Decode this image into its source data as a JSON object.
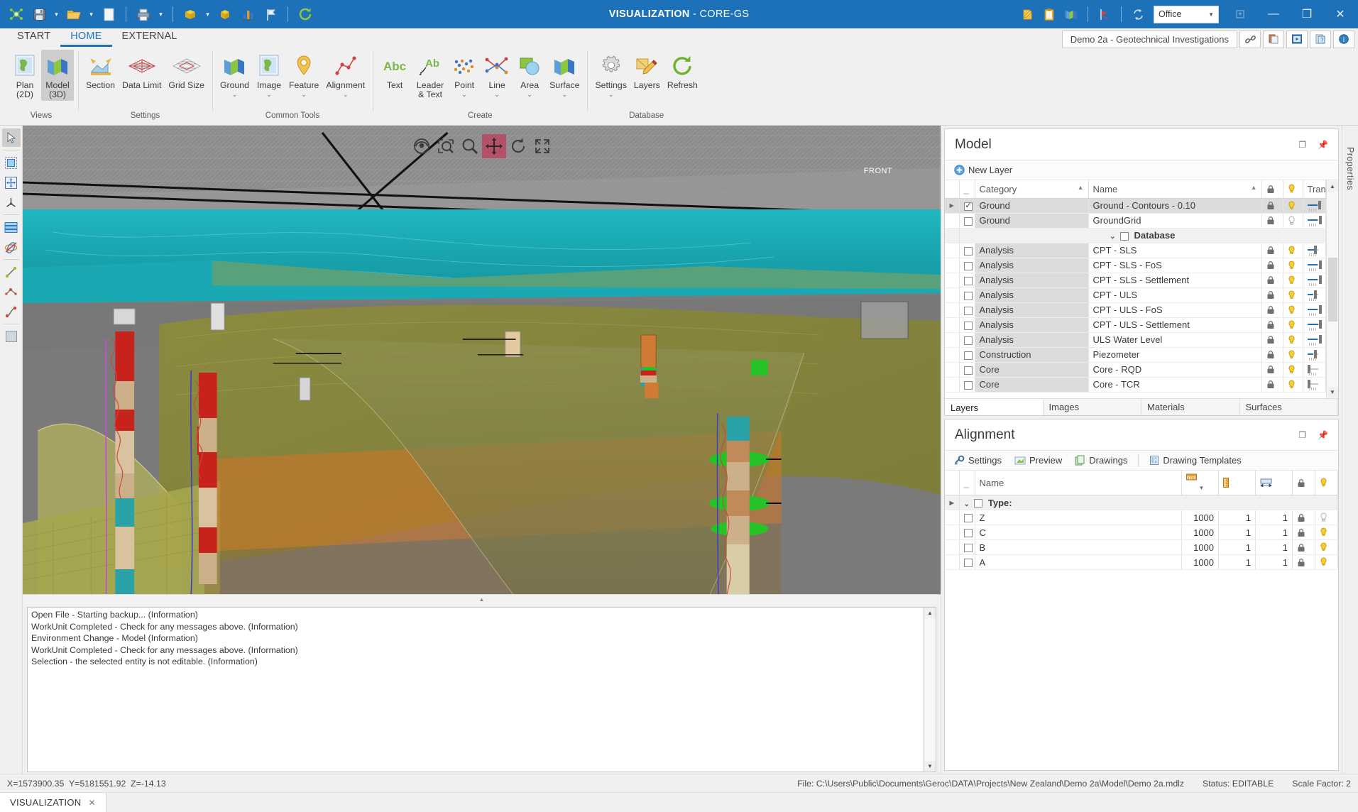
{
  "titlebar": {
    "app_title_prefix": "VISUALIZATION",
    "app_title_suffix": " - CORE-GS",
    "quick_access": [
      {
        "name": "network-icon",
        "label": "Network"
      },
      {
        "name": "save-icon",
        "label": "Save"
      },
      {
        "name": "save-dropdown",
        "label": "Save options"
      },
      {
        "name": "open-folder-icon",
        "label": "Open"
      },
      {
        "name": "open-dropdown",
        "label": "Open options"
      },
      {
        "name": "new-document-icon",
        "label": "New"
      },
      {
        "name": "print-icon",
        "label": "Print"
      },
      {
        "name": "print-dropdown",
        "label": "Print options"
      },
      {
        "name": "cube-yellow-icon",
        "label": "Model"
      },
      {
        "name": "cube-dropdown",
        "label": "Model options"
      },
      {
        "name": "cube-solid-icon",
        "label": "Solid"
      },
      {
        "name": "chart-icon",
        "label": "Chart"
      },
      {
        "name": "flag-icon",
        "label": "Flag"
      },
      {
        "name": "refresh-icon",
        "label": "Refresh"
      }
    ],
    "right_icons": [
      {
        "name": "edit-note-icon",
        "label": "Notes"
      },
      {
        "name": "clipboard-icon",
        "label": "Clipboard"
      },
      {
        "name": "map-icon",
        "label": "Map"
      },
      {
        "name": "section-icon",
        "label": "Section"
      },
      {
        "name": "sync-icon",
        "label": "Sync"
      }
    ],
    "environment_select": "Office",
    "window_buttons": {
      "restore_up": "⇧",
      "minimize": "—",
      "maximize": "❐",
      "close": "✕"
    }
  },
  "ribbon": {
    "tabs": [
      {
        "label": "START",
        "active": false
      },
      {
        "label": "HOME",
        "active": true
      },
      {
        "label": "EXTERNAL",
        "active": false
      }
    ],
    "document_title": "Demo 2a - Geotechnical Investigations",
    "doc_buttons": [
      {
        "name": "link-icon",
        "label": "Link"
      },
      {
        "name": "paste-clipboard-icon",
        "label": "Paste"
      },
      {
        "name": "movie-icon",
        "label": "Movie"
      },
      {
        "name": "help-page-icon",
        "label": "Help"
      },
      {
        "name": "info-icon",
        "label": "Info"
      }
    ],
    "groups": [
      {
        "label": "Views",
        "items": [
          {
            "name": "plan-2d-button",
            "label": "Plan",
            "label2": "(2D)",
            "icon": "map-plan-icon",
            "selected": false,
            "dropdown": false
          },
          {
            "name": "model-3d-button",
            "label": "Model",
            "label2": "(3D)",
            "icon": "map-3d-icon",
            "selected": true,
            "dropdown": false
          }
        ]
      },
      {
        "label": "Settings",
        "items": [
          {
            "name": "section-button",
            "label": "Section",
            "label2": "",
            "icon": "section-icon",
            "selected": false,
            "dropdown": false
          },
          {
            "name": "data-limit-button",
            "label": "Data Limit",
            "label2": "",
            "icon": "data-limit-icon",
            "selected": false,
            "dropdown": false
          },
          {
            "name": "grid-size-button",
            "label": "Grid Size",
            "label2": "",
            "icon": "grid-size-icon",
            "selected": false,
            "dropdown": false
          }
        ]
      },
      {
        "label": "Common Tools",
        "items": [
          {
            "name": "ground-button",
            "label": "Ground",
            "label2": "",
            "icon": "map-3d-icon",
            "selected": false,
            "dropdown": true
          },
          {
            "name": "image-button",
            "label": "Image",
            "label2": "",
            "icon": "map-plan-icon",
            "selected": false,
            "dropdown": true
          },
          {
            "name": "feature-button",
            "label": "Feature",
            "label2": "",
            "icon": "pin-icon",
            "selected": false,
            "dropdown": true
          },
          {
            "name": "alignment-button",
            "label": "Alignment",
            "label2": "",
            "icon": "polyline-icon",
            "selected": false,
            "dropdown": true
          }
        ]
      },
      {
        "label": "Create",
        "items": [
          {
            "name": "text-button",
            "label": "Text",
            "label2": "",
            "icon": "abc-text-icon",
            "selected": false,
            "dropdown": false
          },
          {
            "name": "leader-text-button",
            "label": "Leader",
            "label2": "& Text",
            "icon": "leader-text-icon",
            "selected": false,
            "dropdown": false
          },
          {
            "name": "point-button",
            "label": "Point",
            "label2": "",
            "icon": "points-icon",
            "selected": false,
            "dropdown": true
          },
          {
            "name": "line-button",
            "label": "Line",
            "label2": "",
            "icon": "lines-icon",
            "selected": false,
            "dropdown": true
          },
          {
            "name": "area-button",
            "label": "Area",
            "label2": "",
            "icon": "area-icon",
            "selected": false,
            "dropdown": true
          },
          {
            "name": "surface-button",
            "label": "Surface",
            "label2": "",
            "icon": "map-3d-icon",
            "selected": false,
            "dropdown": true
          }
        ]
      },
      {
        "label": "Database",
        "items": [
          {
            "name": "settings-button",
            "label": "Settings",
            "label2": "",
            "icon": "gear-icon",
            "selected": false,
            "dropdown": true
          },
          {
            "name": "layers-button",
            "label": "Layers",
            "label2": "",
            "icon": "layers-pencil-icon",
            "selected": false,
            "dropdown": false
          },
          {
            "name": "refresh-button",
            "label": "Refresh",
            "label2": "",
            "icon": "refresh-green-icon",
            "selected": false,
            "dropdown": false
          }
        ]
      }
    ]
  },
  "left_toolbar": [
    {
      "name": "select-arrow-tool",
      "selected": true
    },
    {
      "name": "select-window-tool",
      "selected": false
    },
    {
      "name": "move-tool",
      "selected": false
    },
    {
      "name": "axis-tool",
      "selected": false
    },
    {
      "name": "table-tool",
      "selected": false
    },
    {
      "name": "no-orbit-tool",
      "selected": false
    },
    {
      "name": "measure-line-tool",
      "selected": false
    },
    {
      "name": "polyline-tool",
      "selected": false
    },
    {
      "name": "curve-tool",
      "selected": false
    },
    {
      "name": "surface-tool",
      "selected": false
    }
  ],
  "viewport": {
    "tools": [
      {
        "name": "eye-view-tool",
        "active": false
      },
      {
        "name": "zoom-window-tool",
        "active": false
      },
      {
        "name": "zoom-tool",
        "active": false
      },
      {
        "name": "pan-tool",
        "active": true
      },
      {
        "name": "rotate-tool",
        "active": false
      },
      {
        "name": "zoom-extents-tool",
        "active": false
      }
    ],
    "viewcube_label": "FRONT",
    "accent_active_color": "#be3c5a"
  },
  "console": {
    "lines": [
      "Open File - Starting backup... (Information)",
      "WorkUnit Completed - Check for any messages above. (Information)",
      "Environment Change - Model (Information)",
      "WorkUnit Completed - Check for any messages above. (Information)",
      "Selection - the selected entity is not editable. (Information)"
    ]
  },
  "model_panel": {
    "title": "Model",
    "new_layer_label": "New Layer",
    "columns": [
      "",
      "_",
      "Category",
      "Name",
      "lock",
      "bulb",
      "Transparency"
    ],
    "column_labels": {
      "category": "Category",
      "name": "Name",
      "transparency": "Transparency"
    },
    "rows": [
      {
        "expander": true,
        "checked": true,
        "category": "Ground",
        "name": "Ground - Contours - 0.10",
        "lock": "locked",
        "bulb": "on",
        "transparency": 92,
        "selected": true,
        "group": false
      },
      {
        "expander": false,
        "checked": false,
        "category": "Ground",
        "name": "GroundGrid",
        "lock": "locked",
        "bulb": "off",
        "transparency": 95,
        "selected": false,
        "group": false
      },
      {
        "group": true,
        "label": "Database",
        "checked": false
      },
      {
        "expander": false,
        "checked": false,
        "category": "Analysis",
        "name": "CPT - SLS",
        "lock": "locked",
        "bulb": "on",
        "transparency": 60,
        "selected": false,
        "group": false
      },
      {
        "expander": false,
        "checked": false,
        "category": "Analysis",
        "name": "CPT - SLS - FoS",
        "lock": "locked",
        "bulb": "on",
        "transparency": 96,
        "selected": false,
        "group": false
      },
      {
        "expander": false,
        "checked": false,
        "category": "Analysis",
        "name": "CPT - SLS - Settlement",
        "lock": "locked",
        "bulb": "on",
        "transparency": 95,
        "selected": false,
        "group": false
      },
      {
        "expander": false,
        "checked": false,
        "category": "Analysis",
        "name": "CPT - ULS",
        "lock": "locked",
        "bulb": "on",
        "transparency": 58,
        "selected": false,
        "group": false
      },
      {
        "expander": false,
        "checked": false,
        "category": "Analysis",
        "name": "CPT - ULS - FoS",
        "lock": "locked",
        "bulb": "on",
        "transparency": 96,
        "selected": false,
        "group": false
      },
      {
        "expander": false,
        "checked": false,
        "category": "Analysis",
        "name": "CPT - ULS - Settlement",
        "lock": "locked",
        "bulb": "on",
        "transparency": 97,
        "selected": false,
        "group": false
      },
      {
        "expander": false,
        "checked": false,
        "category": "Analysis",
        "name": "ULS Water Level",
        "lock": "locked",
        "bulb": "on",
        "transparency": 96,
        "selected": false,
        "group": false
      },
      {
        "expander": false,
        "checked": false,
        "category": "Construction",
        "name": "Piezometer",
        "lock": "locked",
        "bulb": "on",
        "transparency": 58,
        "selected": false,
        "group": false
      },
      {
        "expander": false,
        "checked": false,
        "category": "Core",
        "name": "Core - RQD",
        "lock": "locked",
        "bulb": "on",
        "transparency": 12,
        "selected": false,
        "group": false
      },
      {
        "expander": false,
        "checked": false,
        "category": "Core",
        "name": "Core - TCR",
        "lock": "locked",
        "bulb": "on",
        "transparency": 12,
        "selected": false,
        "group": false
      }
    ],
    "tabs": [
      {
        "label": "Layers",
        "active": true
      },
      {
        "label": "Images",
        "active": false
      },
      {
        "label": "Materials",
        "active": false
      },
      {
        "label": "Surfaces",
        "active": false
      }
    ]
  },
  "alignment_panel": {
    "title": "Alignment",
    "toolbar": [
      {
        "name": "settings-button",
        "label": "Settings",
        "icon": "wrench-icon"
      },
      {
        "name": "preview-button",
        "label": "Preview",
        "icon": "preview-icon"
      },
      {
        "name": "drawings-button",
        "label": "Drawings",
        "icon": "drawings-icon"
      },
      {
        "name": "drawing-templates-button",
        "label": "Drawing Templates",
        "icon": "template-icon"
      }
    ],
    "columns": {
      "name": "Name"
    },
    "header_icons": [
      {
        "name": "ruler-table-icon"
      },
      {
        "name": "chevron-down-icon"
      },
      {
        "name": "ruler-vertical-icon"
      },
      {
        "name": "width-icon"
      },
      {
        "name": "lock-icon"
      },
      {
        "name": "bulb-icon"
      }
    ],
    "group_label": "Type:",
    "rows": [
      {
        "checked": false,
        "name": "Z",
        "v1": "1000",
        "v2": "1",
        "v3": "1",
        "lock": "locked",
        "bulb": "off"
      },
      {
        "checked": false,
        "name": "C",
        "v1": "1000",
        "v2": "1",
        "v3": "1",
        "lock": "locked",
        "bulb": "on"
      },
      {
        "checked": false,
        "name": "B",
        "v1": "1000",
        "v2": "1",
        "v3": "1",
        "lock": "locked",
        "bulb": "on"
      },
      {
        "checked": false,
        "name": "A",
        "v1": "1000",
        "v2": "1",
        "v3": "1",
        "lock": "locked",
        "bulb": "on"
      }
    ]
  },
  "properties_rail": {
    "label": "Properties"
  },
  "statusbar": {
    "coords": "X=1573900.35  Y=5181551.92  Z=-14.13",
    "file": "File: C:\\Users\\Public\\Documents\\Geroc\\DATA\\Projects\\New Zealand\\Demo 2a\\Model\\Demo 2a.mdlz",
    "status": "Status: EDITABLE",
    "scale": "Scale Factor: 2"
  },
  "taskbar": {
    "doc_tab": "VISUALIZATION",
    "close_glyph": "✕"
  }
}
